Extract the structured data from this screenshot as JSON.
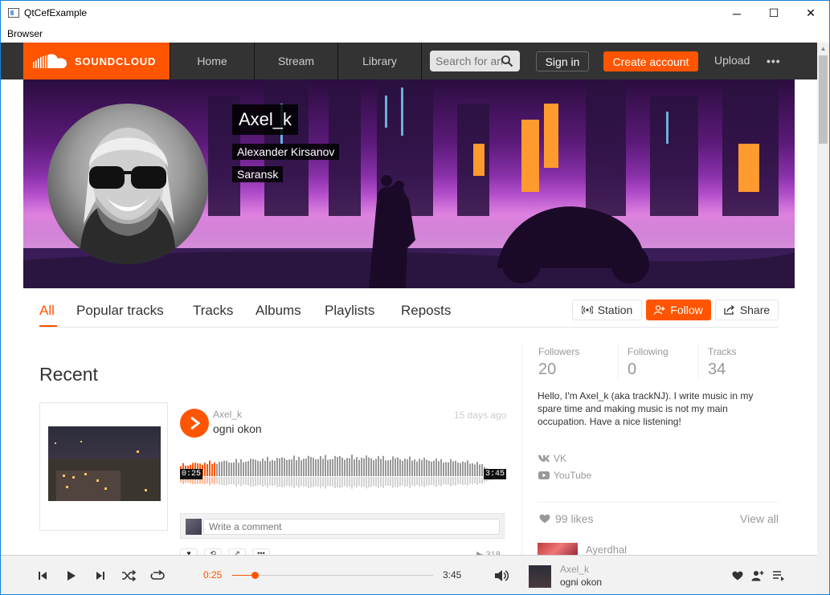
{
  "window": {
    "title": "QtCefExample",
    "menu": "Browser",
    "minimize_glyph": "─",
    "maximize_glyph": "☐",
    "close_glyph": "✕"
  },
  "header": {
    "logo_text": "SOUNDCLOUD",
    "nav": [
      "Home",
      "Stream",
      "Library"
    ],
    "search_placeholder": "Search for artists",
    "sign_in": "Sign in",
    "create_account": "Create account",
    "upload": "Upload",
    "more": "•••",
    "brand_color": "#ff5500"
  },
  "profile": {
    "username": "Axel_k",
    "full_name": "Alexander Kirsanov",
    "city": "Saransk"
  },
  "tabs": [
    "All",
    "Popular tracks",
    "Tracks",
    "Albums",
    "Playlists",
    "Reposts"
  ],
  "active_tab": "All",
  "actions": {
    "station": "Station",
    "follow": "Follow",
    "share": "Share"
  },
  "recent": {
    "heading": "Recent",
    "track": {
      "user": "Axel_k",
      "title": "ogni okon",
      "age": "15 days ago",
      "elapsed": "0:25",
      "duration": "3:45",
      "progress_fraction": 0.111,
      "comment_placeholder": "Write a comment",
      "plays": "▶ 318"
    }
  },
  "sidebar": {
    "stats": [
      {
        "label": "Followers",
        "value": "20"
      },
      {
        "label": "Following",
        "value": "0"
      },
      {
        "label": "Tracks",
        "value": "34"
      }
    ],
    "bio": "Hello, I'm Axel_k (aka trackNJ). I write music in my spare time and making music is not my main occupation. Have a nice listening!",
    "links": [
      {
        "icon": "vk-icon",
        "label": "VK"
      },
      {
        "icon": "youtube-icon",
        "label": "YouTube"
      }
    ],
    "likes_count": "99 likes",
    "view_all": "View all",
    "liked_user": "Ayerdhal"
  },
  "player": {
    "elapsed": "0:25",
    "duration": "3:45",
    "progress_fraction": 0.111,
    "user": "Axel_k",
    "title": "ogni okon"
  }
}
